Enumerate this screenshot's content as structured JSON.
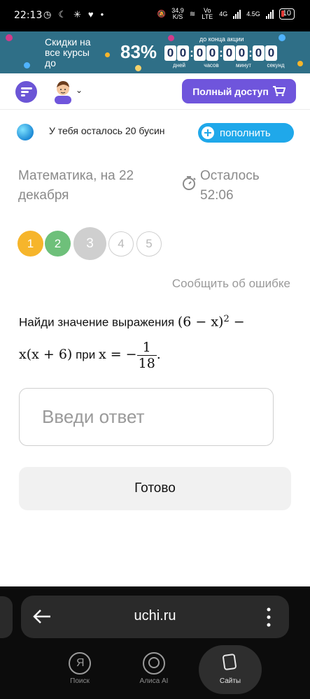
{
  "status_bar": {
    "time": "22:13",
    "left_icons": [
      "alarm-icon",
      "moon-icon",
      "snowflake-icon",
      "heart-icon",
      "dot-icon"
    ],
    "speed_value": "34,9",
    "speed_unit": "K/S",
    "net_1": "Vo LTE",
    "net_2": "4G",
    "net_3": "4.5G",
    "battery": "10"
  },
  "banner": {
    "text": "Скидки на все курсы до",
    "percent": "83%",
    "until": "до конца акции",
    "timer_digits": [
      "0",
      "0",
      "0",
      "0",
      "0",
      "0",
      "0",
      "0"
    ],
    "labels": [
      "дней",
      "часов",
      "минут",
      "секунд"
    ]
  },
  "header": {
    "full_access": "Полный доступ"
  },
  "beads": {
    "text": "У тебя осталось 20 бусин",
    "topup": "пополнить"
  },
  "lesson": {
    "title": "Математика, на 22 декабря",
    "remaining_label": "Осталось",
    "remaining_time": "52:06"
  },
  "steps": [
    "1",
    "2",
    "3",
    "4",
    "5"
  ],
  "report_error": "Сообщить об ошибке",
  "question": {
    "prefix": "Найди значение выражения",
    "expr1": "(6 − x)",
    "exp": "2",
    "minus": " −",
    "expr2": "x(x + 6)",
    "when": "при",
    "xeq": "x = −",
    "num": "1",
    "den": "18",
    "end": "."
  },
  "answer_placeholder": "Введи ответ",
  "done_button": "Готово",
  "browser": {
    "url": "uchi.ru",
    "nav": [
      {
        "label": "Поиск",
        "icon": "yandex-search-icon"
      },
      {
        "label": "Алиса AI",
        "icon": "alice-icon"
      },
      {
        "label": "Сайты",
        "icon": "tabs-icon"
      }
    ]
  }
}
